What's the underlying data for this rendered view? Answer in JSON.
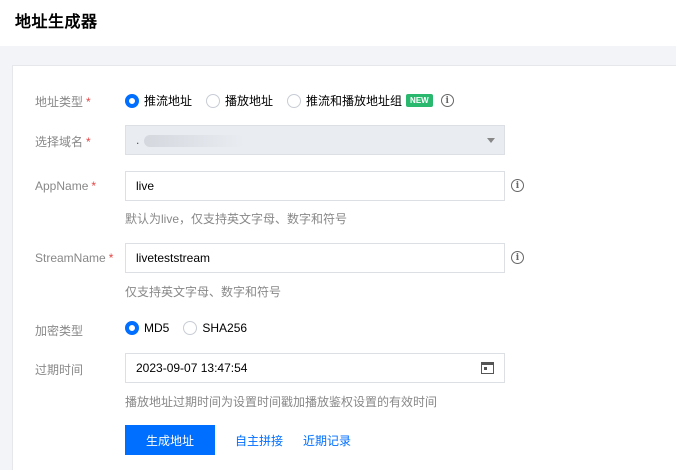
{
  "header": {
    "title": "地址生成器"
  },
  "form": {
    "address_type": {
      "label": "地址类型",
      "required": "*",
      "options": [
        {
          "label": "推流地址",
          "checked": true
        },
        {
          "label": "播放地址",
          "checked": false
        },
        {
          "label": "推流和播放地址组",
          "checked": false
        }
      ],
      "badge": "NEW",
      "info_icon": "info-icon"
    },
    "domain": {
      "label": "选择域名",
      "required": "*",
      "value": "."
    },
    "app_name": {
      "label": "AppName",
      "required": "*",
      "value": "live",
      "hint": "默认为live，仅支持英文字母、数字和符号"
    },
    "stream_name": {
      "label": "StreamName",
      "required": "*",
      "value": "liveteststream",
      "hint": "仅支持英文字母、数字和符号"
    },
    "encryption": {
      "label": "加密类型",
      "options": [
        {
          "label": "MD5",
          "checked": true
        },
        {
          "label": "SHA256",
          "checked": false
        }
      ]
    },
    "expiry": {
      "label": "过期时间",
      "value": "2023-09-07 13:47:54",
      "hint": "播放地址过期时间为设置时间戳加播放鉴权设置的有效时间",
      "icon": "calendar-icon"
    }
  },
  "actions": {
    "generate": "生成地址",
    "custom": "自主拼接",
    "recent": "近期记录"
  },
  "colors": {
    "primary": "#006eff",
    "required": "#e54545",
    "badge": "#29b86e"
  }
}
